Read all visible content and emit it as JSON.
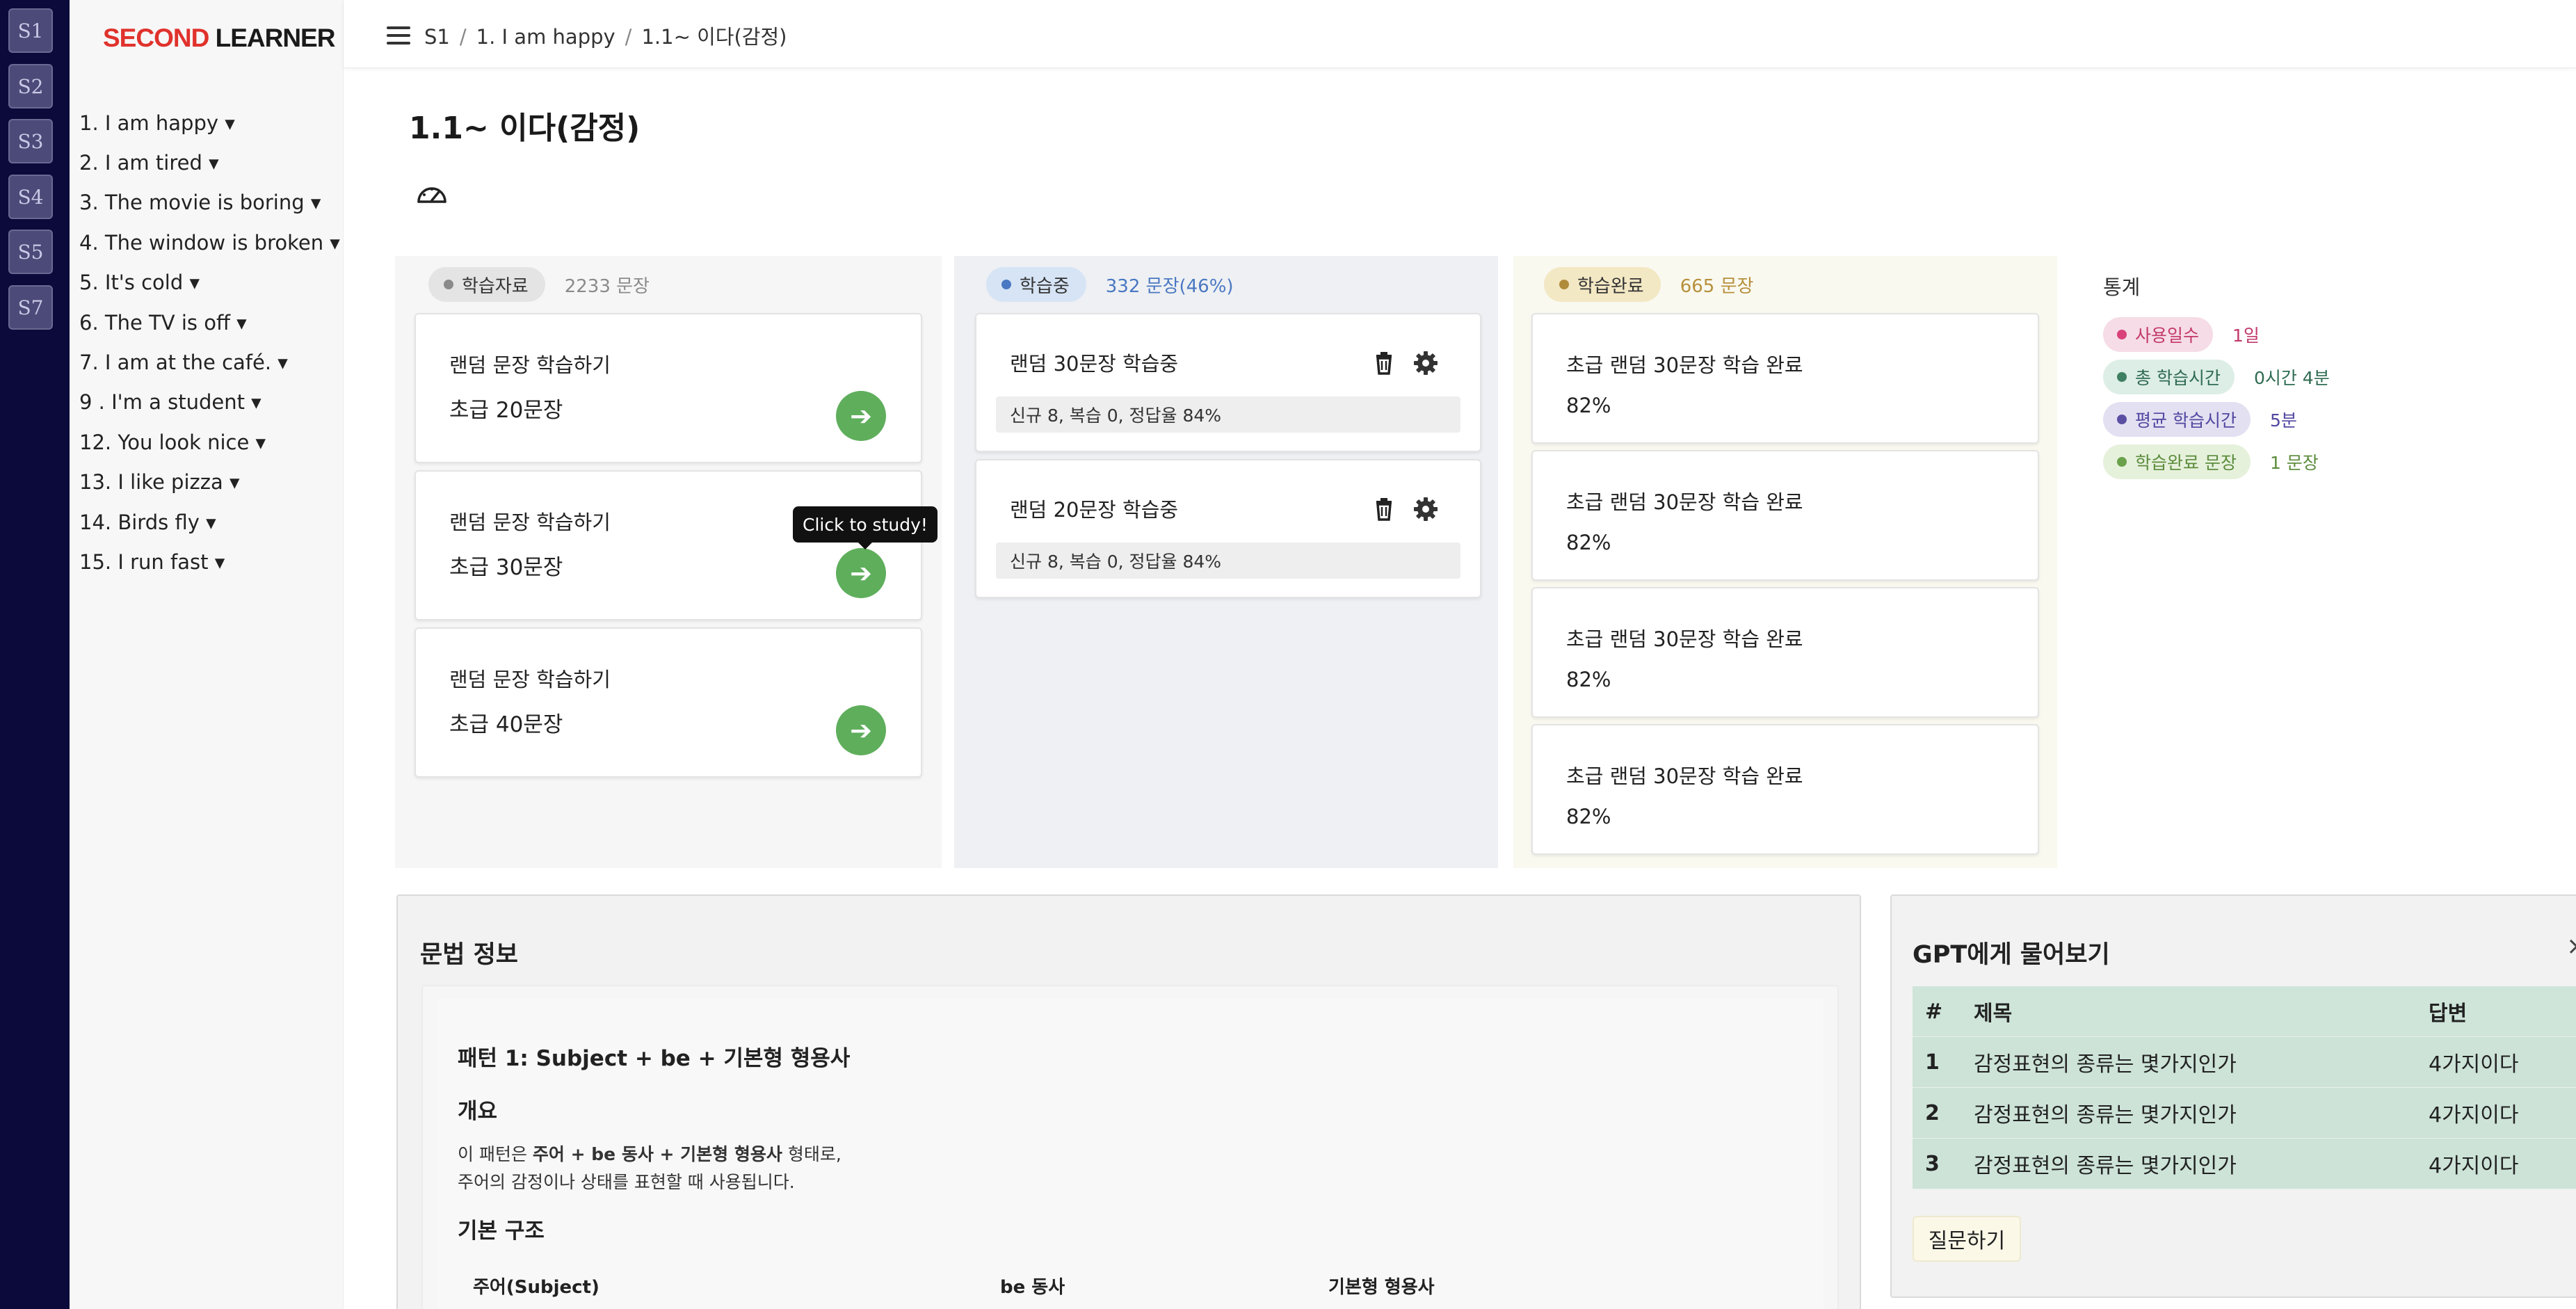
{
  "rail": [
    "S1",
    "S2",
    "S3",
    "S4",
    "S5",
    "S7"
  ],
  "logo": {
    "part1": "SECOND",
    "part2": " LEARNER"
  },
  "sidebar": {
    "items": [
      "1. I am happy ▾",
      "2. I am tired ▾",
      "3. The movie is boring ▾",
      "4. The window is broken ▾",
      "5. It's cold ▾",
      "6. The TV is off ▾",
      "7. I am at the café. ▾",
      "9 . I'm a student ▾",
      "12. You look nice ▾",
      "13. I like pizza ▾",
      "14. Birds fly ▾",
      "15. I run fast ▾"
    ]
  },
  "breadcrumb": [
    "S1",
    "1. I am happy",
    "1.1~ 이다(감정)"
  ],
  "page_title": "1.1~ 이다(감정)",
  "columns": {
    "materials": {
      "label": "학습자료",
      "count": "2233 문장",
      "cards": [
        {
          "title": "랜덤 문장 학습하기",
          "sub": "초급 20문장"
        },
        {
          "title": "랜덤 문장 학습하기",
          "sub": "초급 30문장"
        },
        {
          "title": "랜덤 문장 학습하기",
          "sub": "초급 40문장"
        }
      ],
      "go_symbol": "➔",
      "tooltip": "Click to study!"
    },
    "studying": {
      "label": "학습중",
      "count": "332 문장(46%)",
      "cards": [
        {
          "title": "랜덤 30문장 학습중",
          "progress": "신규 8, 복습 0, 정답율 84%"
        },
        {
          "title": "랜덤 20문장 학습중",
          "progress": "신규 8, 복습 0, 정답율 84%"
        }
      ]
    },
    "done": {
      "label": "학습완료",
      "count": "665 문장",
      "cards": [
        {
          "title": "초급 랜덤 30문장 학습 완료",
          "score": "82%"
        },
        {
          "title": "초급 랜덤 30문장 학습 완료",
          "score": "82%"
        },
        {
          "title": "초급 랜덤 30문장 학습 완료",
          "score": "82%"
        },
        {
          "title": "초급 랜덤 30문장 학습 완료",
          "score": "82%"
        }
      ]
    }
  },
  "stats": {
    "title": "통계",
    "rows": [
      {
        "label": "사용일수",
        "value": "1일",
        "bg": "#f6dce6",
        "dot": "#d9417a",
        "color": "#c2386b"
      },
      {
        "label": "총 학습시간",
        "value": "0시간 4분",
        "bg": "#ddeee6",
        "dot": "#3f7f62",
        "color": "#2f6b52"
      },
      {
        "label": "평균 학습시간",
        "value": "5분",
        "bg": "#e3e0f2",
        "dot": "#5b4fa3",
        "color": "#5147a0"
      },
      {
        "label": "학습완료 문장",
        "value": "1 문장",
        "bg": "#e6f1dc",
        "dot": "#6aa14a",
        "color": "#5c8c3c"
      }
    ]
  },
  "grammar": {
    "title": "문법 정보",
    "pattern": "패턴 1: Subject + be + 기본형 형용사",
    "overview_title": "개요",
    "line1_pre": "이 패턴은 ",
    "line1_bold": "주어 + be 동사 + 기본형 형용사",
    "line1_post": " 형태로,",
    "line2": "주어의 감정이나 상태를 표현할 때 사용됩니다.",
    "structure_title": "기본 구조",
    "table_headers": [
      "주어(Subject)",
      "be 동사",
      "기본형 형용사"
    ]
  },
  "gpt": {
    "title": "GPT에게 물어보기",
    "close": "×",
    "headers": [
      "#",
      "제목",
      "답변"
    ],
    "rows": [
      [
        "1",
        "감정표현의 종류는 몇가지인가",
        "4가지이다"
      ],
      [
        "2",
        "감정표현의 종류는 몇가지인가",
        "4가지이다"
      ],
      [
        "3",
        "감정표현의 종류는 몇가지인가",
        "4가지이다"
      ]
    ],
    "ask_label": "질문하기"
  },
  "colors": {
    "rail_bg": "#0b0a3a",
    "logo_red": "#e0322c",
    "go_button": "#5fae5c",
    "materials_pill": "#e4e4e4",
    "studying_pill": "#d6e4f5",
    "done_pill": "#f3e8c4"
  }
}
